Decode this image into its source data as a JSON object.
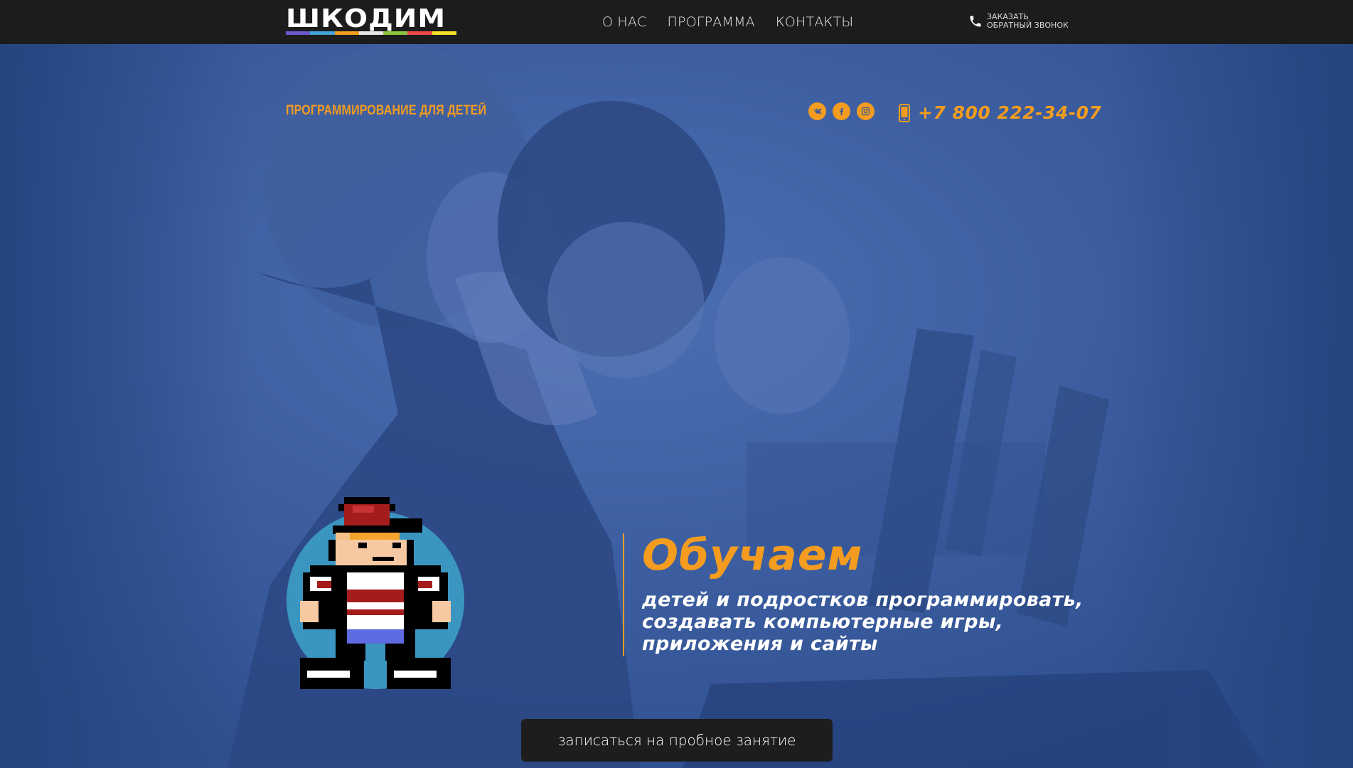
{
  "brand": {
    "logo_text": "ШКОДИМ",
    "stripe_colors": [
      "#6a5acd",
      "#3fa3d8",
      "#f39c1f",
      "#e8e8e8",
      "#8cc63f",
      "#e84a4a",
      "#f5e028"
    ]
  },
  "nav": {
    "items": [
      {
        "label": "О НАС"
      },
      {
        "label": "ПРОГРАММА"
      },
      {
        "label": "КОНТАКТЫ"
      }
    ]
  },
  "callback": {
    "line1": "ЗАКАЗАТЬ",
    "line2": "ОБРАТНЫЙ ЗВОНОК",
    "icon": "phone-icon"
  },
  "hero": {
    "tagline": "ПРОГРАММИРОВАНИЕ ДЛЯ ДЕТЕЙ",
    "social_icons": [
      "vk-icon",
      "facebook-icon",
      "instagram-icon"
    ],
    "phone": "+7 800 222-34-07",
    "headline": "Обучаем",
    "subhead": [
      "детей и подростков программировать,",
      "создавать компьютерные игры,",
      "приложения и сайты"
    ],
    "cta_label": "записаться на пробное занятие"
  },
  "colors": {
    "accent": "#f39c1f",
    "topbar": "#1c1c1c",
    "hero_overlay": "#3a5a9c",
    "mascot_circle": "#3a95c0"
  }
}
